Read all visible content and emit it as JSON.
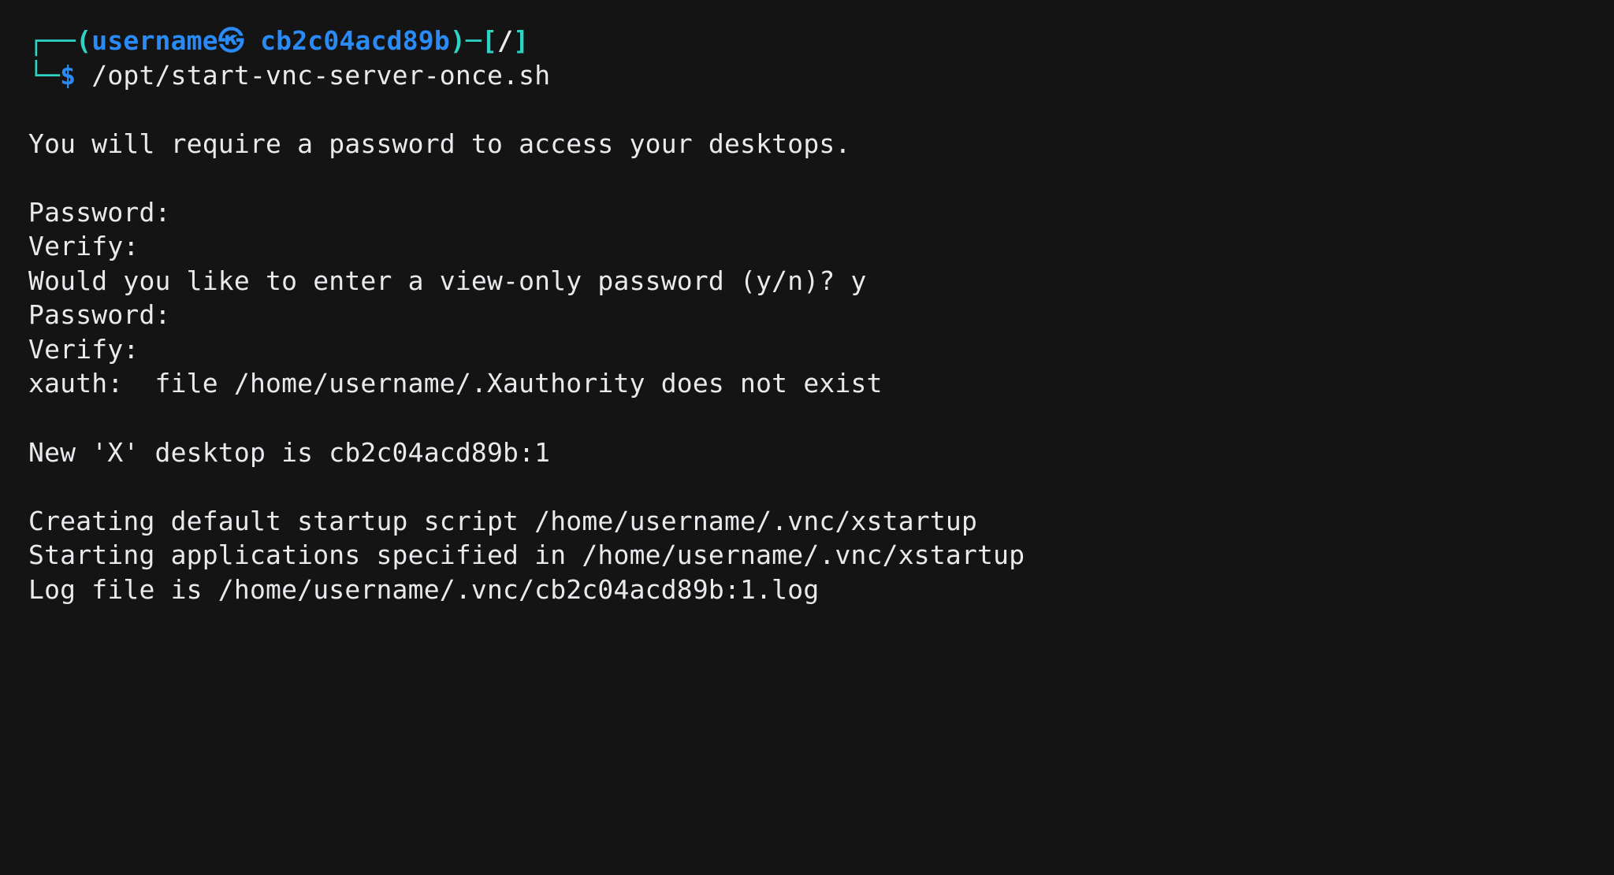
{
  "prompt": {
    "tl_corner": "┌──",
    "bl_corner": "└─",
    "open_paren": "(",
    "close_paren": ")",
    "username": "username",
    "at_glyph": "㉿",
    "host": "cb2c04acd89b",
    "dash": "─",
    "open_bracket": "[",
    "cwd": "/",
    "close_bracket": "]",
    "dollar": "$",
    "command": "/opt/start-vnc-server-once.sh"
  },
  "output": {
    "l1": "You will require a password to access your desktops.",
    "l2": "Password:",
    "l3": "Verify:",
    "l4": "Would you like to enter a view-only password (y/n)? y",
    "l5": "Password:",
    "l6": "Verify:",
    "l7": "xauth:  file /home/username/.Xauthority does not exist",
    "l8": "New 'X' desktop is cb2c04acd89b:1",
    "l9": "Creating default startup script /home/username/.vnc/xstartup",
    "l10": "Starting applications specified in /home/username/.vnc/xstartup",
    "l11": "Log file is /home/username/.vnc/cb2c04acd89b:1.log"
  },
  "colors": {
    "background": "#141414",
    "foreground": "#e8eaed",
    "cyan": "#2fd3c4",
    "blue": "#2a8af6"
  }
}
